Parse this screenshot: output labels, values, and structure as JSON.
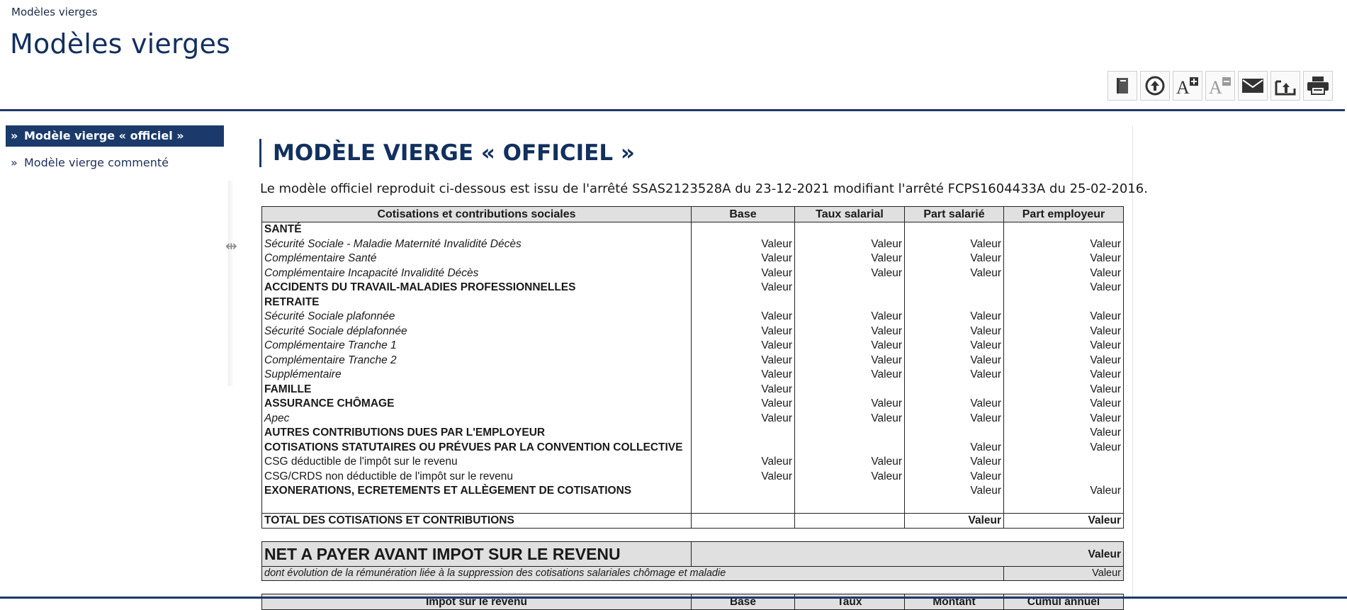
{
  "breadcrumb": "Modèles vierges",
  "page_title": "Modèles vierges",
  "toolbar": [
    {
      "icon": "book-icon",
      "color": "#555555"
    },
    {
      "icon": "upload-circle-icon",
      "color": "#333333"
    },
    {
      "icon": "font-increase-icon",
      "color": "#333333"
    },
    {
      "icon": "font-decrease-icon",
      "color": "#9a9a9a"
    },
    {
      "icon": "mail-icon",
      "color": "#333333"
    },
    {
      "icon": "share-icon",
      "color": "#333333"
    },
    {
      "icon": "print-icon",
      "color": "#333333"
    }
  ],
  "sidebar": {
    "items": [
      {
        "label": "Modèle vierge « officiel »",
        "active": true
      },
      {
        "label": "Modèle vierge commenté",
        "active": false
      }
    ]
  },
  "section_title": "MODÈLE VIERGE « OFFICIEL »",
  "intro": "Le modèle officiel reproduit ci-dessous est issu de l'arrêté SSAS2123528A du 23-12-2021 modifiant l'arrêté FCPS1604433A du 25-02-2016.",
  "table": {
    "headers": [
      "Cotisations et contributions sociales",
      "Base",
      "Taux salarial",
      "Part salarié",
      "Part employeur"
    ],
    "rows": [
      {
        "type": "section",
        "cells": [
          "SANTÉ",
          "",
          "",
          "",
          ""
        ]
      },
      {
        "type": "item",
        "cells": [
          "Sécurité Sociale - Maladie Maternité Invalidité Décès",
          "Valeur",
          "Valeur",
          "Valeur",
          "Valeur"
        ]
      },
      {
        "type": "item",
        "cells": [
          "Complémentaire Santé",
          "Valeur",
          "Valeur",
          "Valeur",
          "Valeur"
        ]
      },
      {
        "type": "item",
        "cells": [
          "Complémentaire Incapacité Invalidité Décès",
          "Valeur",
          "Valeur",
          "Valeur",
          "Valeur"
        ]
      },
      {
        "type": "section",
        "cells": [
          "ACCIDENTS DU TRAVAIL-MALADIES PROFESSIONNELLES",
          "Valeur",
          "",
          "",
          "Valeur"
        ]
      },
      {
        "type": "section",
        "cells": [
          "RETRAITE",
          "",
          "",
          "",
          ""
        ]
      },
      {
        "type": "item",
        "cells": [
          "Sécurité Sociale plafonnée",
          "Valeur",
          "Valeur",
          "Valeur",
          "Valeur"
        ]
      },
      {
        "type": "item",
        "cells": [
          "Sécurité Sociale déplafonnée",
          "Valeur",
          "Valeur",
          "Valeur",
          "Valeur"
        ]
      },
      {
        "type": "item",
        "cells": [
          "Complémentaire Tranche 1",
          "Valeur",
          "Valeur",
          "Valeur",
          "Valeur"
        ]
      },
      {
        "type": "item",
        "cells": [
          "Complémentaire Tranche 2",
          "Valeur",
          "Valeur",
          "Valeur",
          "Valeur"
        ]
      },
      {
        "type": "item",
        "cells": [
          "Supplémentaire",
          "Valeur",
          "Valeur",
          "Valeur",
          "Valeur"
        ]
      },
      {
        "type": "section",
        "cells": [
          "FAMILLE",
          "Valeur",
          "",
          "",
          "Valeur"
        ]
      },
      {
        "type": "section",
        "cells": [
          "ASSURANCE CHÔMAGE",
          "Valeur",
          "Valeur",
          "Valeur",
          "Valeur"
        ]
      },
      {
        "type": "item",
        "cells": [
          "Apec",
          "Valeur",
          "Valeur",
          "Valeur",
          "Valeur"
        ]
      },
      {
        "type": "section",
        "cells": [
          "AUTRES CONTRIBUTIONS DUES PAR L'EMPLOYEUR",
          "",
          "",
          "",
          "Valeur"
        ]
      },
      {
        "type": "section",
        "cells": [
          "COTISATIONS STATUTAIRES OU PRÉVUES PAR LA CONVENTION COLLECTIVE",
          "",
          "",
          "Valeur",
          "Valeur"
        ]
      },
      {
        "type": "plain",
        "cells": [
          "CSG déductible de l'impôt sur le revenu",
          "Valeur",
          "Valeur",
          "Valeur",
          ""
        ]
      },
      {
        "type": "plain",
        "cells": [
          "CSG/CRDS non déductible de l'impôt sur le revenu",
          "Valeur",
          "Valeur",
          "Valeur",
          ""
        ]
      },
      {
        "type": "section",
        "cells": [
          "EXONERATIONS, ECRETEMENTS ET ALLÈGEMENT DE COTISATIONS",
          "",
          "",
          "Valeur",
          "Valeur"
        ]
      },
      {
        "type": "blank",
        "cells": [
          "",
          "",
          "",
          "",
          ""
        ]
      },
      {
        "type": "boxed",
        "cells": [
          "TOTAL DES COTISATIONS ET CONTRIBUTIONS",
          "",
          "",
          "Valeur",
          "Valeur"
        ]
      }
    ],
    "net": {
      "label": "NET A PAYER AVANT IMPOT SUR LE REVENU",
      "value": "Valeur"
    },
    "net_note": {
      "label": "dont évolution de la rémunération liée à la suppression des cotisations salariales chômage et maladie",
      "value": "Valeur"
    },
    "tax_headers": [
      "Impot sur le revenu",
      "Base",
      "Taux",
      "Montant",
      "Cumul annuel"
    ]
  }
}
